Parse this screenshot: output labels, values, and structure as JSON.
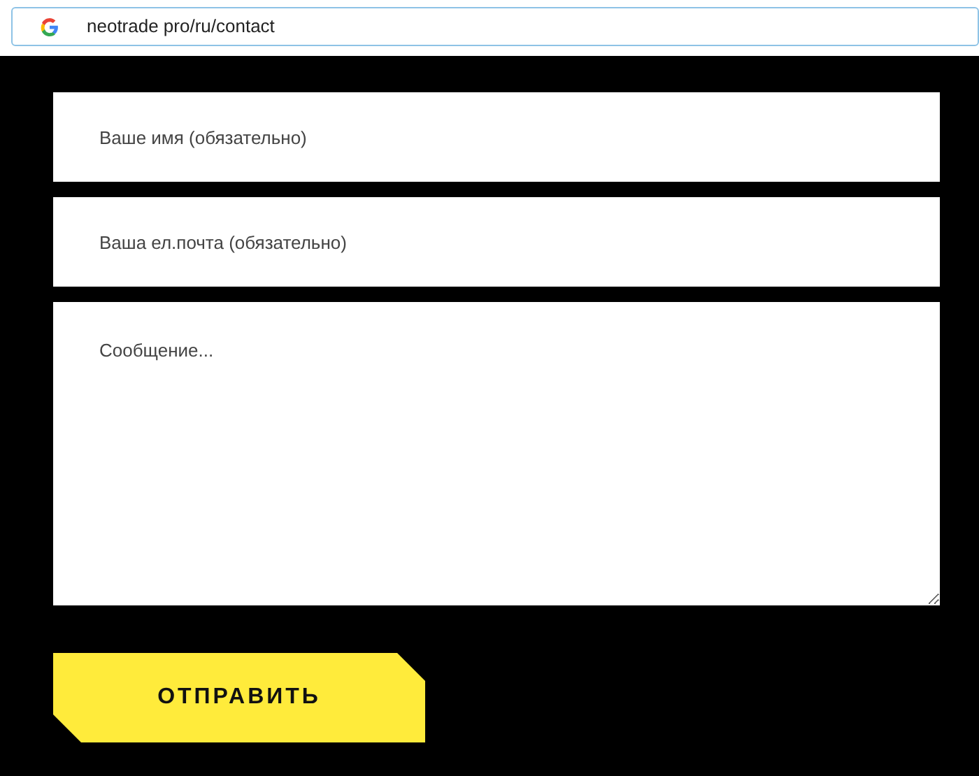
{
  "address_bar": {
    "url": "neotrade pro/ru/contact"
  },
  "form": {
    "name_field": {
      "placeholder": "Ваше имя (обязательно)"
    },
    "email_field": {
      "placeholder": "Ваша ел.почта (обязательно)"
    },
    "message_field": {
      "placeholder": "Сообщение..."
    },
    "submit_button": "ОТПРАВИТЬ"
  }
}
